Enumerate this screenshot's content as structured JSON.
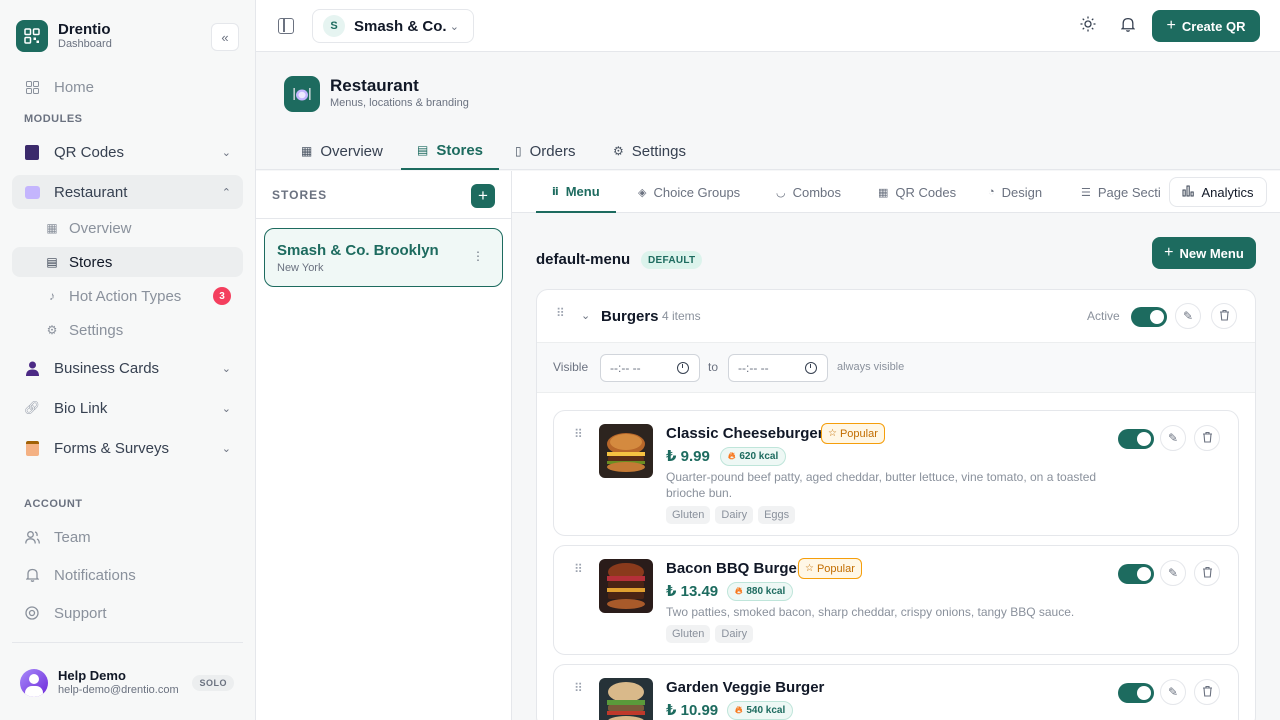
{
  "brand": {
    "name": "Drentio",
    "subtitle": "Dashboard"
  },
  "sidebar": {
    "home": "Home",
    "modules_label": "MODULES",
    "qr_codes": "QR Codes",
    "restaurant": "Restaurant",
    "restaurant_sub": {
      "overview": "Overview",
      "stores": "Stores",
      "hot_action_types": "Hot Action Types",
      "hot_action_count": "3",
      "settings": "Settings"
    },
    "business_cards": "Business Cards",
    "bio_link": "Bio Link",
    "forms_surveys": "Forms & Surveys",
    "account_label": "ACCOUNT",
    "team": "Team",
    "notifications": "Notifications",
    "support": "Support"
  },
  "user": {
    "name": "Help Demo",
    "email": "help-demo@drentio.com",
    "plan": "SOLO"
  },
  "topbar": {
    "store_initial": "S",
    "store_name": "Smash & Co.",
    "create_label": "Create QR"
  },
  "page": {
    "title": "Restaurant",
    "subtitle": "Menus, locations & branding",
    "tabs": {
      "overview": "Overview",
      "stores": "Stores",
      "orders": "Orders",
      "settings": "Settings"
    }
  },
  "stores": {
    "title": "STORES",
    "items": [
      {
        "name": "Smash & Co. Brooklyn",
        "location": "New York"
      }
    ]
  },
  "subtabs": {
    "menu": "Menu",
    "choice_groups": "Choice Groups",
    "combos": "Combos",
    "qr_codes": "QR Codes",
    "design": "Design",
    "page_sections": "Page Secti",
    "analytics": "Analytics"
  },
  "menu": {
    "name": "default-menu",
    "badge": "DEFAULT",
    "new_menu_label": "New Menu",
    "category": {
      "name": "Burgers",
      "count": "4 items",
      "active_label": "Active",
      "visible_label": "Visible",
      "time_placeholder": "--:-- --",
      "to_label": "to",
      "always_visible": "always visible"
    },
    "items": [
      {
        "name": "Classic Cheeseburger",
        "popular": "Popular",
        "price": "₺ 9.99",
        "kcal": "620 kcal",
        "description": "Quarter-pound beef patty, aged cheddar, butter lettuce, vine tomato, on a toasted brioche bun.",
        "tags": [
          "Gluten",
          "Dairy",
          "Eggs"
        ]
      },
      {
        "name": "Bacon BBQ Burger",
        "popular": "Popular",
        "price": "₺ 13.49",
        "kcal": "880 kcal",
        "description": "Two patties, smoked bacon, sharp cheddar, crispy onions, tangy BBQ sauce.",
        "tags": [
          "Gluten",
          "Dairy"
        ]
      },
      {
        "name": "Garden Veggie Burger",
        "price": "₺ 10.99",
        "kcal": "540 kcal"
      }
    ]
  },
  "colors": {
    "accent": "#1d6b5f",
    "danger_badge": "#f43f5e",
    "popular": "#f59e0b"
  }
}
